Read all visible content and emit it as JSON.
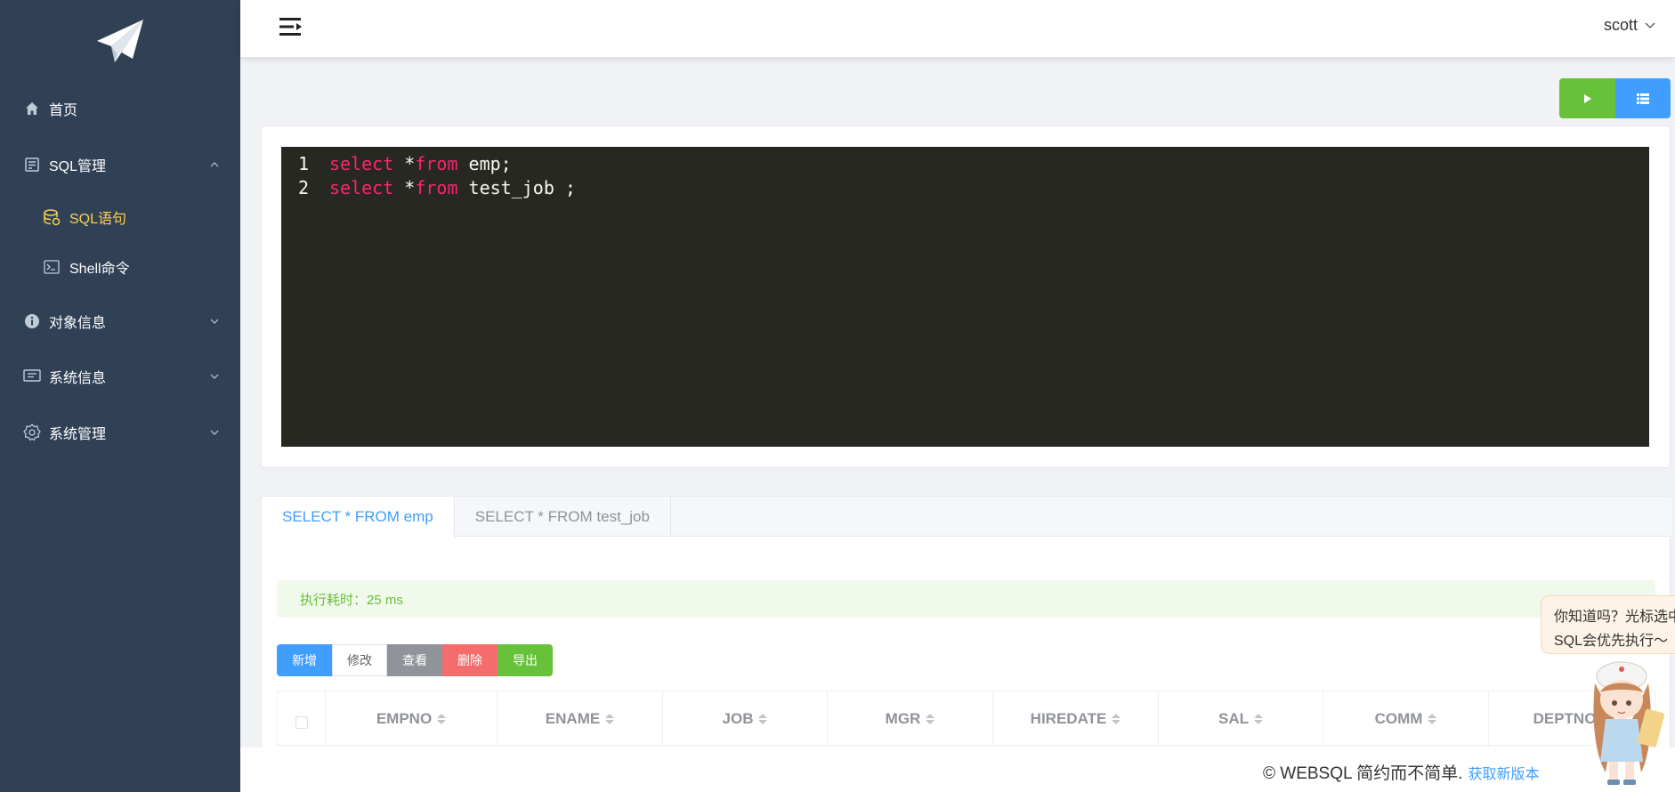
{
  "sidebar": {
    "items": [
      {
        "label": "首页",
        "icon": "home-icon"
      },
      {
        "label": "SQL管理",
        "icon": "server-icon"
      },
      {
        "label": "对象信息",
        "icon": "info-icon"
      },
      {
        "label": "系统信息",
        "icon": "monitor-icon"
      },
      {
        "label": "系统管理",
        "icon": "gear-icon"
      }
    ],
    "sub_items": [
      {
        "label": "SQL语句",
        "icon": "database-icon",
        "active": true
      },
      {
        "label": "Shell命令",
        "icon": "terminal-icon",
        "active": false
      }
    ]
  },
  "header": {
    "user": "scott"
  },
  "editor": {
    "lines": [
      {
        "number": "1",
        "keyword1": "select",
        "rest1": " *",
        "keyword2": "from",
        "rest2": " emp;"
      },
      {
        "number": "2",
        "keyword1": "select",
        "rest1": " *",
        "keyword2": "from",
        "rest2": " test_job ;"
      }
    ]
  },
  "results": {
    "tabs": [
      {
        "label": "SELECT * FROM emp",
        "active": true
      },
      {
        "label": "SELECT * FROM test_job",
        "active": false
      }
    ],
    "timing": "执行耗时：25 ms",
    "ops": {
      "add": "新增",
      "edit": "修改",
      "view": "查看",
      "delete": "删除",
      "export": "导出"
    },
    "columns": [
      "EMPNO",
      "ENAME",
      "JOB",
      "MGR",
      "HIREDATE",
      "SAL",
      "COMM",
      "DEPTNO"
    ]
  },
  "tip": {
    "line1": "你知道吗？光标选中",
    "line2": "SQL会优先执行～"
  },
  "footer": {
    "text": "© WEBSQL 简约而不简单.",
    "link": "获取新版本"
  },
  "colors": {
    "sidebar_bg": "#304156",
    "active_menu": "#ffd04b",
    "primary": "#409eff",
    "success": "#67c23a",
    "danger": "#f56c6c",
    "info": "#909399",
    "editor_bg": "#272822",
    "keyword": "#f92672"
  }
}
